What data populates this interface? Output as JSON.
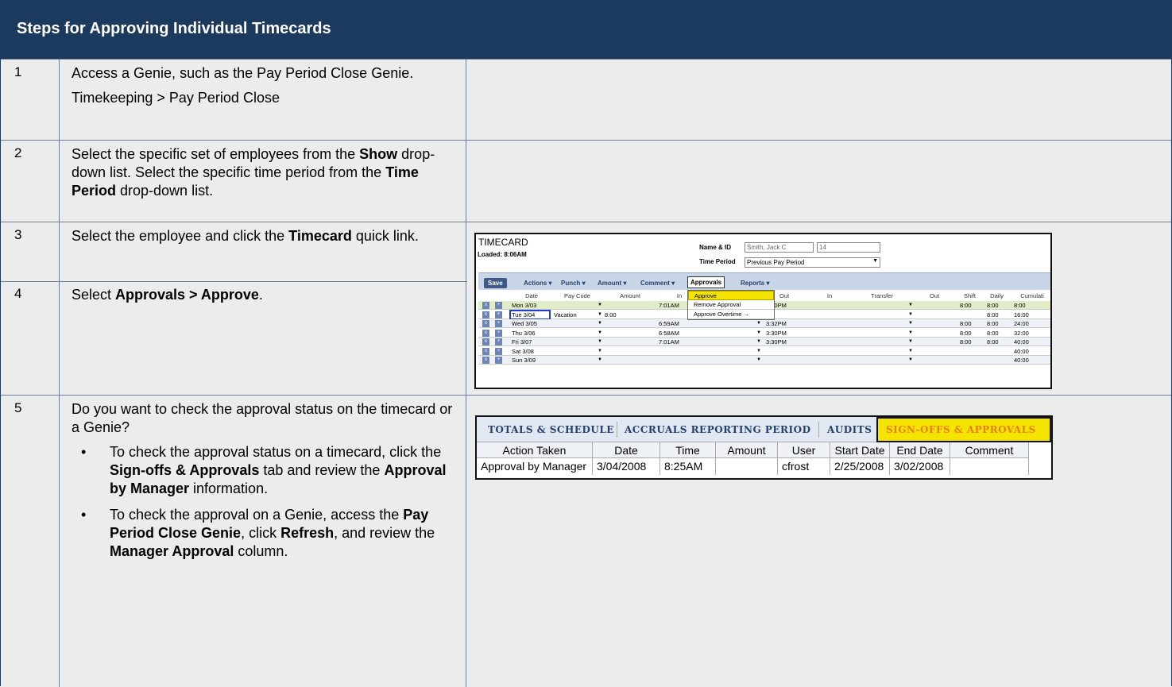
{
  "doc_title": "Steps for Approving Individual Timecards",
  "steps": [
    {
      "num": "1",
      "line1": "Access a Genie, such as the Pay Period Close Genie.",
      "line2": "Timekeeping > Pay Period Close"
    },
    {
      "num": "2",
      "t1": "Select the specific set of employees from the ",
      "b1": "Show",
      "t2": " drop-down list. Select the specific time period from the ",
      "b2": "Time Period",
      "t3": " drop-down list."
    },
    {
      "num": "3",
      "t1": "Select the employee and click the ",
      "b1": "Timecard",
      "t2": " quick link."
    },
    {
      "num": "4",
      "t1": "Select ",
      "b1": "Approvals > Approve",
      "t2": "."
    },
    {
      "num": "5",
      "intro": "Do you want to check the approval status on the timecard or a Genie?",
      "bullet1": {
        "t1": "To check the approval status on a timecard, click the ",
        "b1": "Sign-offs & Approvals",
        "t2": " tab and review the ",
        "b2": "Approval by Manager",
        "t3": " information."
      },
      "bullet2": {
        "t1": "To check the approval on a Genie, access the ",
        "b1": "Pay Period Close Genie",
        "t2": ", click ",
        "b2": "Refresh",
        "t3": ", and review the ",
        "b3": "Manager Approval",
        "t4": " column."
      }
    }
  ],
  "timecard": {
    "title": "TIMECARD",
    "loaded": "Loaded: 8:06AM",
    "name_label": "Name & ID",
    "name_value": "Smith, Jack C",
    "id_value": "14",
    "period_label": "Time Period",
    "period_value": "Previous Pay Period",
    "save": "Save",
    "menus": [
      "Actions ▾",
      "Punch ▾",
      "Amount ▾",
      "Comment ▾",
      "Approvals",
      "Reports ▾"
    ],
    "headers": [
      "Date",
      "Pay Code",
      "Amount",
      "In",
      "Out",
      "In",
      "Transfer",
      "Out",
      "Shift",
      "Daily",
      "Cumulati"
    ],
    "rows": [
      {
        "date": "Mon 3/03",
        "paycode": "",
        "amount": "",
        "in": "7:01AM",
        "out": "3:30PM",
        "shift": "8:00",
        "daily": "8:00",
        "cum": "8:00"
      },
      {
        "date": "Tue 3/04",
        "paycode": "Vacation",
        "amount": "8:00",
        "in": "",
        "out": "",
        "shift": "",
        "daily": "8:00",
        "cum": "16:00"
      },
      {
        "date": "Wed 3/05",
        "paycode": "",
        "amount": "",
        "in": "6:59AM",
        "out": "3:32PM",
        "shift": "8:00",
        "daily": "8:00",
        "cum": "24:00"
      },
      {
        "date": "Thu 3/06",
        "paycode": "",
        "amount": "",
        "in": "6:58AM",
        "out": "3:30PM",
        "shift": "8:00",
        "daily": "8:00",
        "cum": "32:00"
      },
      {
        "date": "Fri 3/07",
        "paycode": "",
        "amount": "",
        "in": "7:01AM",
        "out": "3:30PM",
        "shift": "8:00",
        "daily": "8:00",
        "cum": "40:00"
      },
      {
        "date": "Sat 3/08",
        "paycode": "",
        "amount": "",
        "in": "",
        "out": "",
        "shift": "",
        "daily": "",
        "cum": "40:00"
      },
      {
        "date": "Sun 3/09",
        "paycode": "",
        "amount": "",
        "in": "",
        "out": "",
        "shift": "",
        "daily": "",
        "cum": "40:00"
      }
    ],
    "dropdown": [
      "Approve",
      "Remove Approval",
      "Approve Overtime →"
    ]
  },
  "signoffs": {
    "tabs": [
      "TOTALS & SCHEDULE",
      "ACCRUALS REPORTING PERIOD",
      "AUDITS"
    ],
    "active_tab": "SIGN-OFFS & APPROVALS",
    "headers": [
      "Action Taken",
      "Date",
      "Time",
      "Amount",
      "User",
      "Start Date",
      "End Date",
      "Comment"
    ],
    "row": [
      "Approval by Manager",
      "3/04/2008",
      "8:25AM",
      "",
      "cfrost",
      "2/25/2008",
      "3/02/2008",
      ""
    ]
  }
}
